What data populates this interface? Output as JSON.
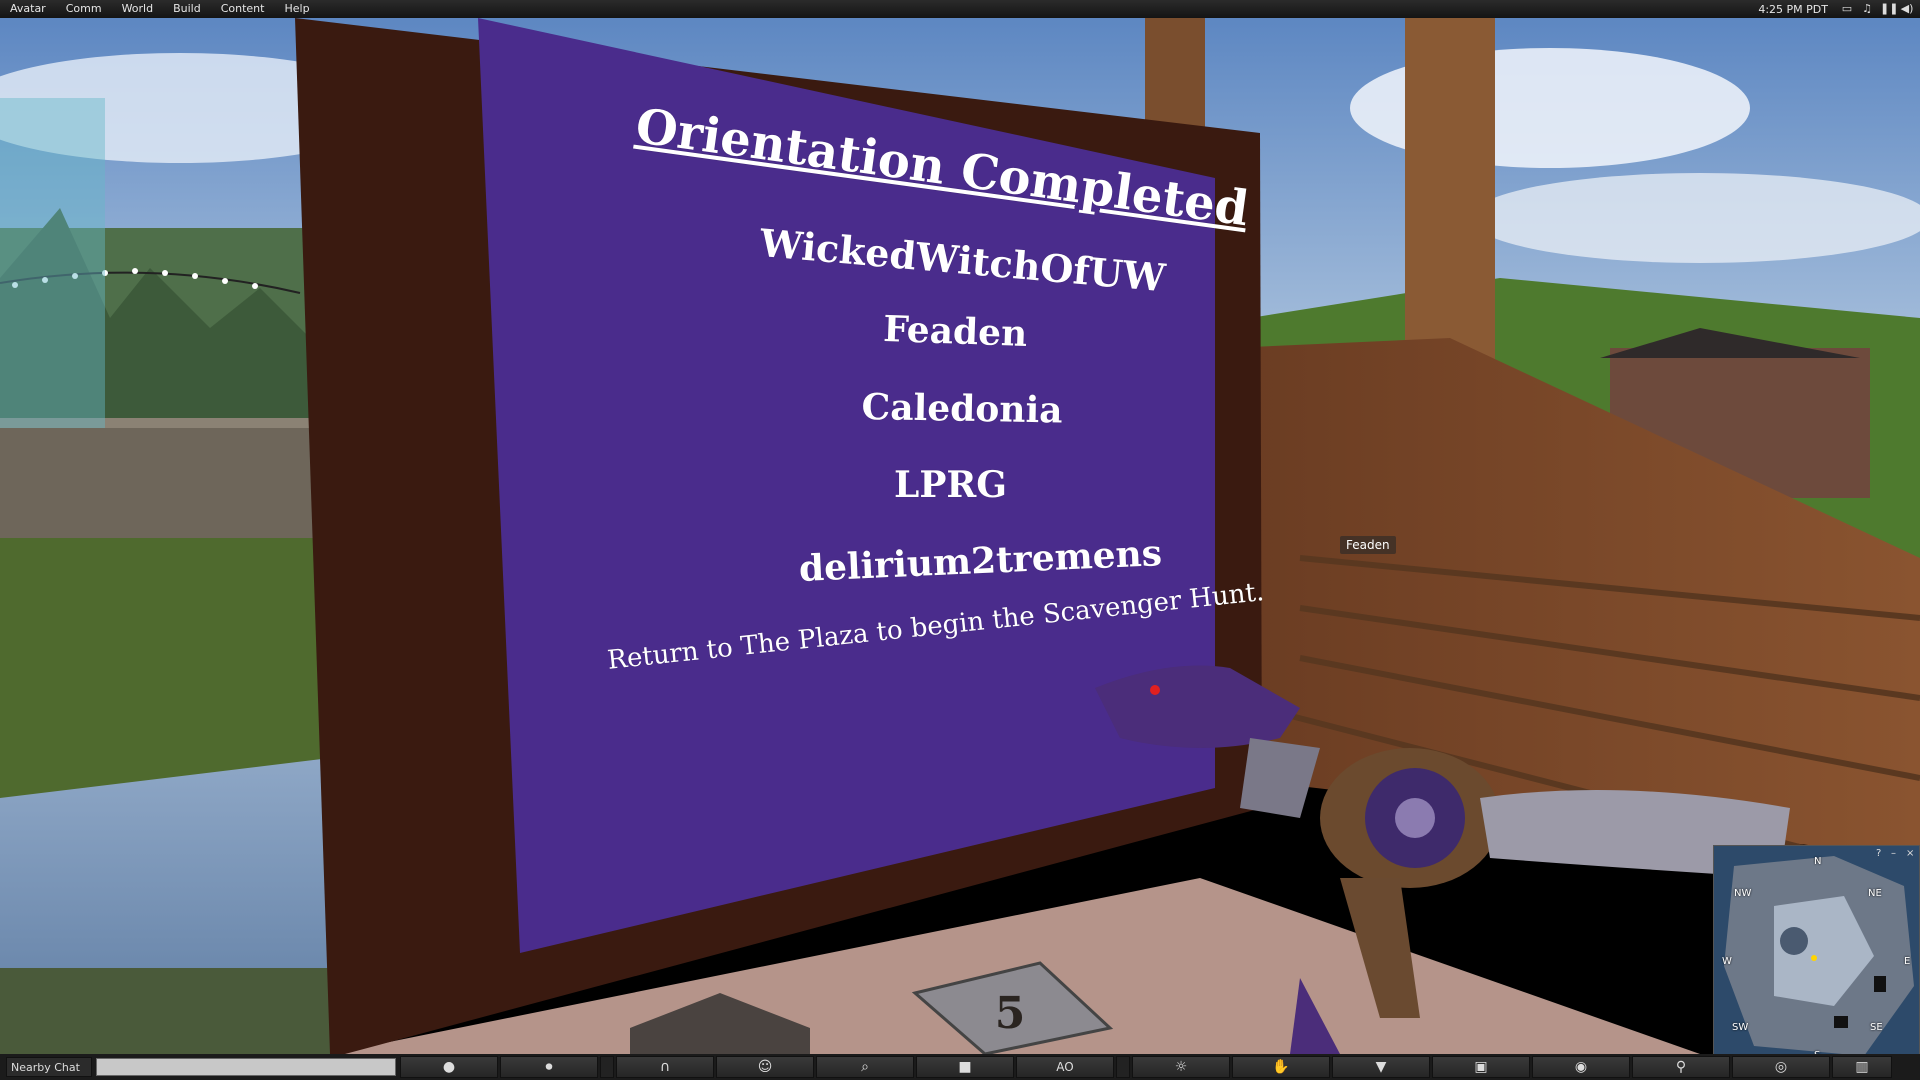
{
  "menubar": {
    "items": [
      "Avatar",
      "Comm",
      "World",
      "Build",
      "Content",
      "Help"
    ],
    "clock": "4:25 PM PDT"
  },
  "sign": {
    "title": "Orientation Completed",
    "names": [
      "WickedWitchOfUW",
      "Feaden",
      "Caledonia",
      "LPRG",
      "delirium2tremens"
    ],
    "message": "Return to The Plaza to begin the Scavenger Hunt."
  },
  "avatar_tag": "Feaden",
  "floor_tile_number": "5",
  "minimap": {
    "labels": [
      "N",
      "NW",
      "NE",
      "W",
      "E",
      "SW",
      "SE",
      "S"
    ],
    "controls": [
      "?",
      "–",
      "×"
    ]
  },
  "bottombar": {
    "chat_label": "Nearby Chat",
    "chat_value": "",
    "buttons": [
      {
        "name": "speak",
        "label": "",
        "icon": "speech-bubble-icon"
      },
      {
        "name": "voice",
        "label": "",
        "icon": "microphone-icon"
      },
      {
        "name": "audio",
        "label": "",
        "icon": "headphones-icon"
      },
      {
        "name": "people",
        "label": "",
        "icon": "people-icon"
      },
      {
        "name": "search",
        "label": "",
        "icon": "search-icon"
      },
      {
        "name": "snapshot",
        "label": "",
        "icon": "camera-icon"
      },
      {
        "name": "ao",
        "label": "AO",
        "icon": ""
      },
      {
        "name": "gestures",
        "label": "",
        "icon": "gesture-icon"
      },
      {
        "name": "build",
        "label": "",
        "icon": "build-icon"
      },
      {
        "name": "appearance",
        "label": "",
        "icon": "shirt-icon"
      },
      {
        "name": "inventory",
        "label": "",
        "icon": "inventory-icon"
      },
      {
        "name": "view",
        "label": "",
        "icon": "eye-icon"
      },
      {
        "name": "move",
        "label": "",
        "icon": "walk-icon"
      },
      {
        "name": "minimap",
        "label": "",
        "icon": "radar-icon"
      },
      {
        "name": "world-map",
        "label": "",
        "icon": "map-icon"
      }
    ]
  },
  "colors": {
    "sign_purple": "#4a2c8c",
    "frame_brown": "#3a1a10",
    "sky": "#7fa7d4"
  }
}
